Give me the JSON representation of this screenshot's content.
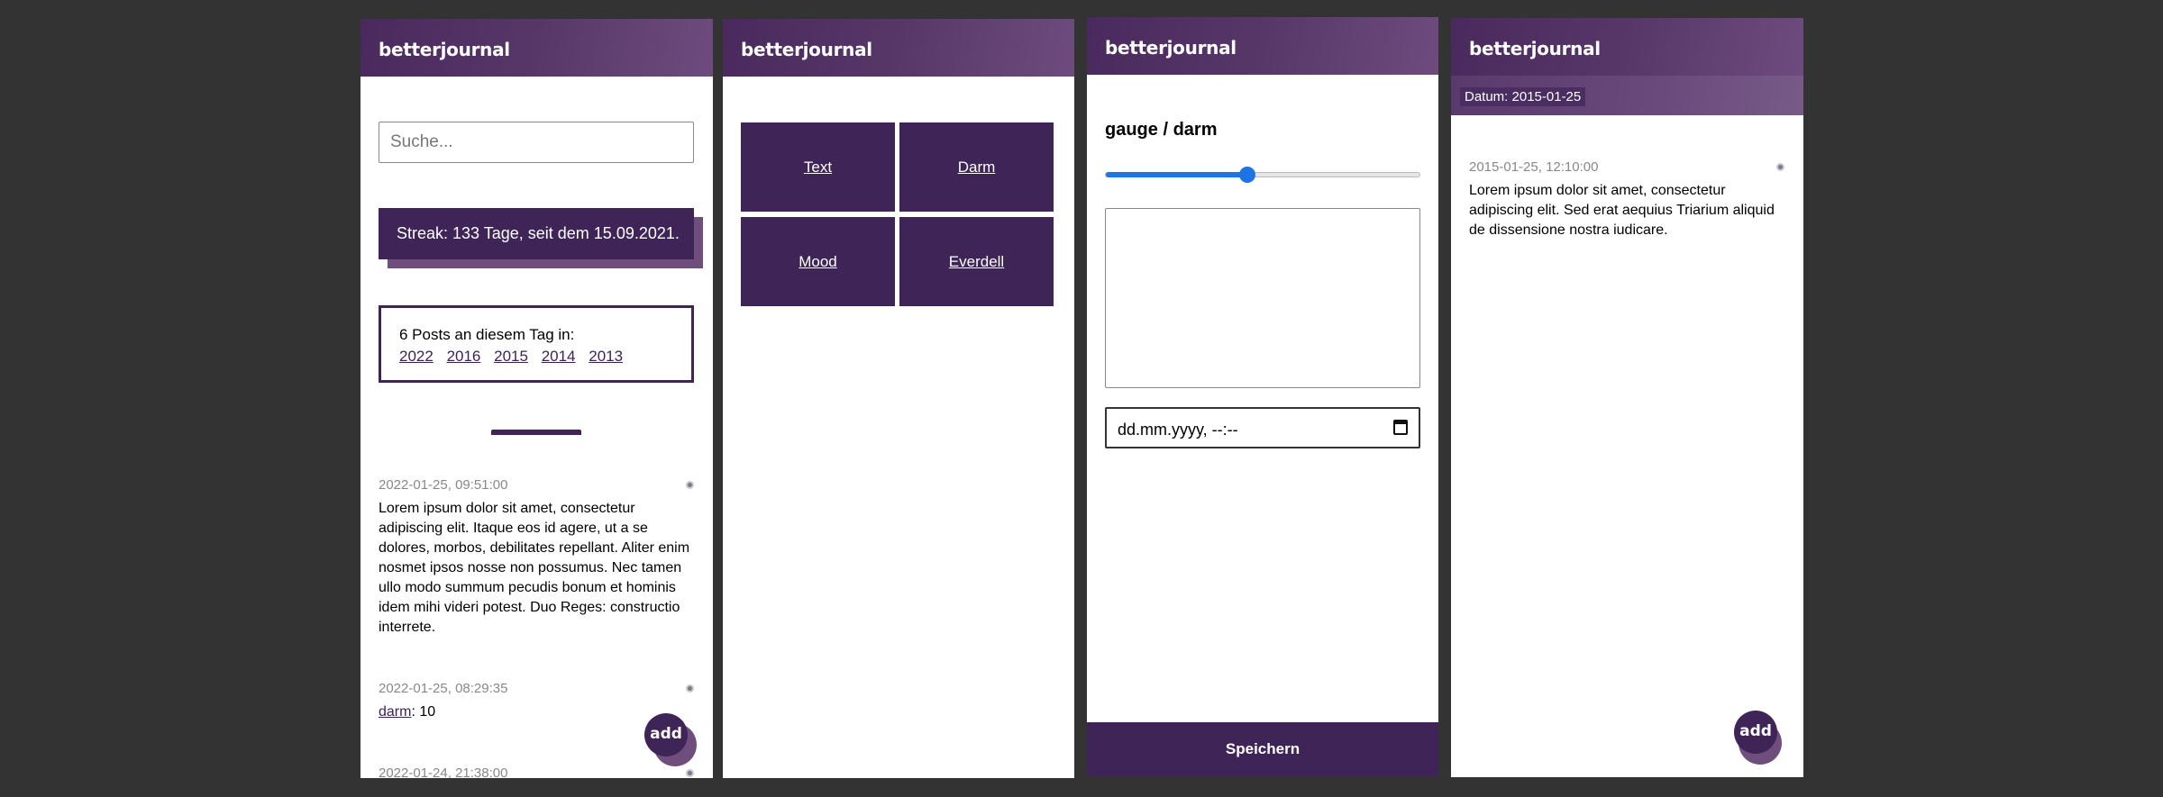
{
  "app": {
    "title": "betterjournal"
  },
  "home": {
    "search_placeholder": "Suche...",
    "streak_text": "Streak: 133 Tage, seit dem 15.09.2021.",
    "posts_on_day_label": "6 Posts an diesem Tag in:",
    "years": [
      "2022",
      "2016",
      "2015",
      "2014",
      "2013"
    ],
    "entries": [
      {
        "timestamp": "2022-01-25, 09:51:00",
        "text": "Lorem ipsum dolor sit amet, consectetur adipiscing elit. Itaque eos id agere, ut a se dolores, morbos, debilitates repellant. Aliter enim nosmet ipsos nosse non possumus. Nec tamen ullo modo summum pecudis bonum et hominis idem mihi videri potest. Duo Reges: constructio interrete."
      },
      {
        "timestamp": "2022-01-25, 08:29:35",
        "gauge_link": "darm",
        "gauge_value": ": 10"
      },
      {
        "timestamp": "2022-01-24, 21:38:00"
      }
    ],
    "fab_label": "add"
  },
  "menu": {
    "tiles": [
      "Text",
      "Darm",
      "Mood",
      "Everdell"
    ]
  },
  "gauge_form": {
    "title": "gauge / darm",
    "slider_value": 0.45,
    "datetime_placeholder": "dd.mm.yyyy, --:--",
    "save_label": "Speichern"
  },
  "day_view": {
    "date_chip": "Datum: 2015-01-25",
    "entry_timestamp": "2015-01-25, 12:10:00",
    "entry_text": "Lorem ipsum dolor sit amet, consectetur adipiscing elit. Sed erat aequius Triarium aliquid de dissensione nostra iudicare.",
    "fab_label": "add"
  },
  "colors": {
    "primary": "#3f2457",
    "primary_light": "#6f4e7e",
    "background": "#333333",
    "slider_blue": "#1f74e5"
  }
}
